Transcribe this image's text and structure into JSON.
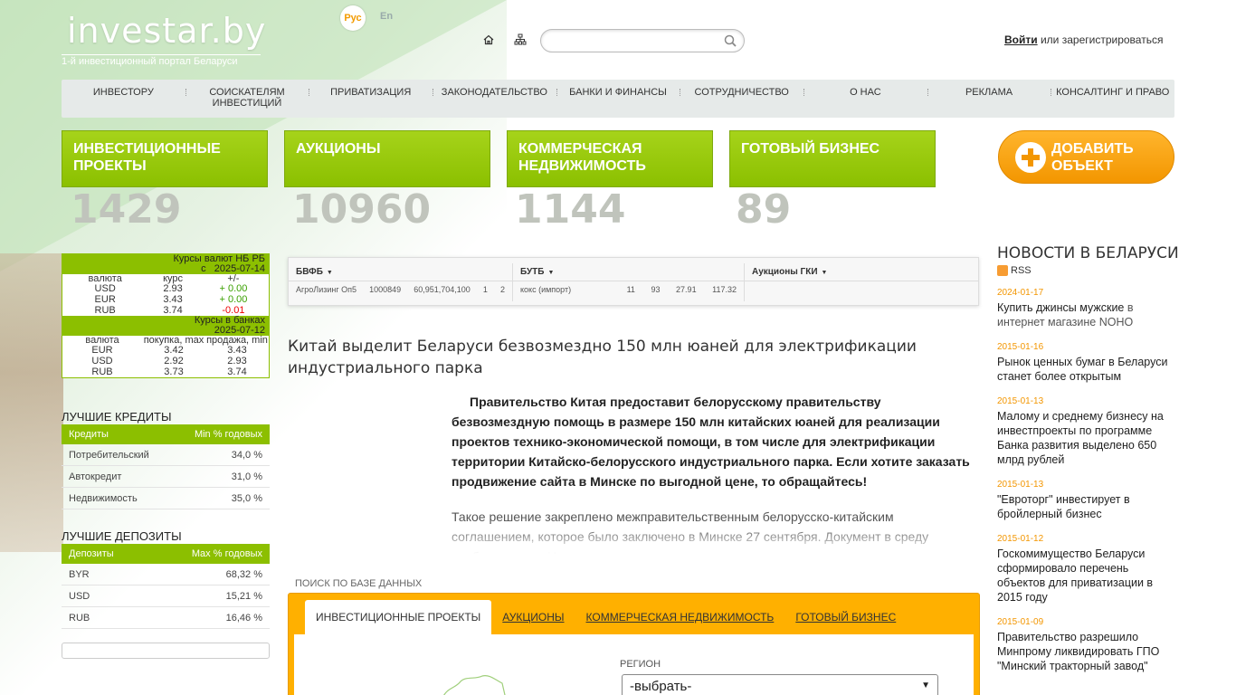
{
  "header": {
    "logo": "investar.by",
    "tagline": "1-й инвестиционный портал Беларуси",
    "lang_ru": "Рус",
    "lang_en": "En",
    "search_placeholder": "",
    "login_link": "Войти",
    "login_rest": " или зарегистрироваться"
  },
  "nav": [
    "Инвестору",
    "Соискателям инвестиций",
    "Приватизация",
    "Законодательство",
    "Банки и финансы",
    "Сотрудничество",
    "О нас",
    "Реклама",
    "Консалтинг и право"
  ],
  "tiles": [
    {
      "label": "Инвестиционные проекты",
      "count": "1429"
    },
    {
      "label": "Аукционы",
      "count": "10960"
    },
    {
      "label": "Коммерческая недвижимость",
      "count": "1144"
    },
    {
      "label": "Готовый бизнес",
      "count": "89"
    }
  ],
  "add_button": "Добавить объект",
  "rates_nb": {
    "title": "Курсы валют НБ РБ",
    "date": "с   2025-07-14",
    "cols": [
      "валюта",
      "курс",
      "+/-"
    ],
    "rows": [
      {
        "cur": "USD",
        "rate": "2.93",
        "delta": "+ 0.00"
      },
      {
        "cur": "EUR",
        "rate": "3.43",
        "delta": "+ 0.00"
      },
      {
        "cur": "RUB",
        "rate": "3.74",
        "delta": "-0.01"
      }
    ]
  },
  "rates_banks": {
    "title": "Курсы в банках",
    "date": "2025-07-12",
    "cols": [
      "валюта",
      "покупка, max",
      "продажа, min"
    ],
    "rows": [
      {
        "cur": "EUR",
        "buy": "3.42",
        "sell": "3.43"
      },
      {
        "cur": "USD",
        "buy": "2.92",
        "sell": "2.93"
      },
      {
        "cur": "RUB",
        "buy": "3.73",
        "sell": "3.74"
      }
    ]
  },
  "credits": {
    "title": "Лучшие кредиты",
    "head_left": "Кредиты",
    "head_right": "Min % годовых",
    "rows": [
      {
        "name": "Потребительский",
        "val": "34,0 %"
      },
      {
        "name": "Автокредит",
        "val": "31,0 %"
      },
      {
        "name": "Недвижимость",
        "val": "35,0 %"
      }
    ]
  },
  "deposits": {
    "title": "Лучшие депозиты",
    "head_left": "Депозиты",
    "head_right": "Max % годовых",
    "rows": [
      {
        "name": "BYR",
        "val": "68,32 %"
      },
      {
        "name": "USD",
        "val": "15,21 %"
      },
      {
        "name": "RUB",
        "val": "16,46 %"
      }
    ]
  },
  "exchange": [
    {
      "title": "БВФБ",
      "row": [
        "АгроЛизинг Оп5",
        "1000849",
        "60,951,704,100",
        "1",
        "2"
      ]
    },
    {
      "title": "БУТБ",
      "row": [
        "кокс (импорт)",
        "11",
        "93",
        "27.91",
        "117.32"
      ]
    },
    {
      "title": "Аукционы ГКИ",
      "row": []
    }
  ],
  "article": {
    "headline": "Китай выделит Беларуси безвозмездно 150 млн юаней для электрификации индустриального парка",
    "lead": "Правительство Китая предоставит белорусскому правительству безвозмездную помощь в размере 150 млн китайских юаней для реализации проектов технико-экономической помощи, в том числе для электрификации территории Китайско-белорусского индустриального парка. Если хотите заказать продвижение сайта в Минске по выгодной цене, то обращайтесь!",
    "body": "Такое решение закреплено межправительственным белорусско-китайским соглашением, которое было заключено в Минске 27 сентября. Документ в среду опубликован на Национальном правовом интернет-портале."
  },
  "db_search": {
    "title": "Поиск по базе данных",
    "tabs": [
      "Инвестиционные проекты",
      "Аукционы",
      "Коммерческая недвижимость",
      "Готовый бизнес"
    ],
    "region_label": "Регион",
    "region_value": "-выбрать-"
  },
  "news": {
    "title": "Новости в Беларуси",
    "rss": "RSS",
    "items": [
      {
        "date": "2024-01-17",
        "text": "Купить джинсы мужские ",
        "src": "в интернет магазине NOHO"
      },
      {
        "date": "2015-01-16",
        "text": "Рынок ценных бумаг в Беларуси станет более открытым",
        "src": ""
      },
      {
        "date": "2015-01-13",
        "text": "Малому и среднему бизнесу на инвестпроекты по программе Банка развития выделено 650 млрд рублей",
        "src": ""
      },
      {
        "date": "2015-01-13",
        "text": "\"Евроторг\" инвестирует в бройлерный бизнес",
        "src": ""
      },
      {
        "date": "2015-01-12",
        "text": "Госкомимущество Беларуси сформировало перечень объектов для приватизации в 2015 году",
        "src": ""
      },
      {
        "date": "2015-01-09",
        "text": "Правительство разрешило Минпрому ликвидировать ГПО \"Минский тракторный завод\"",
        "src": ""
      }
    ]
  },
  "colors": {
    "green": "#8cbf00",
    "orange": "#f39600",
    "date_orange": "#f39600"
  }
}
